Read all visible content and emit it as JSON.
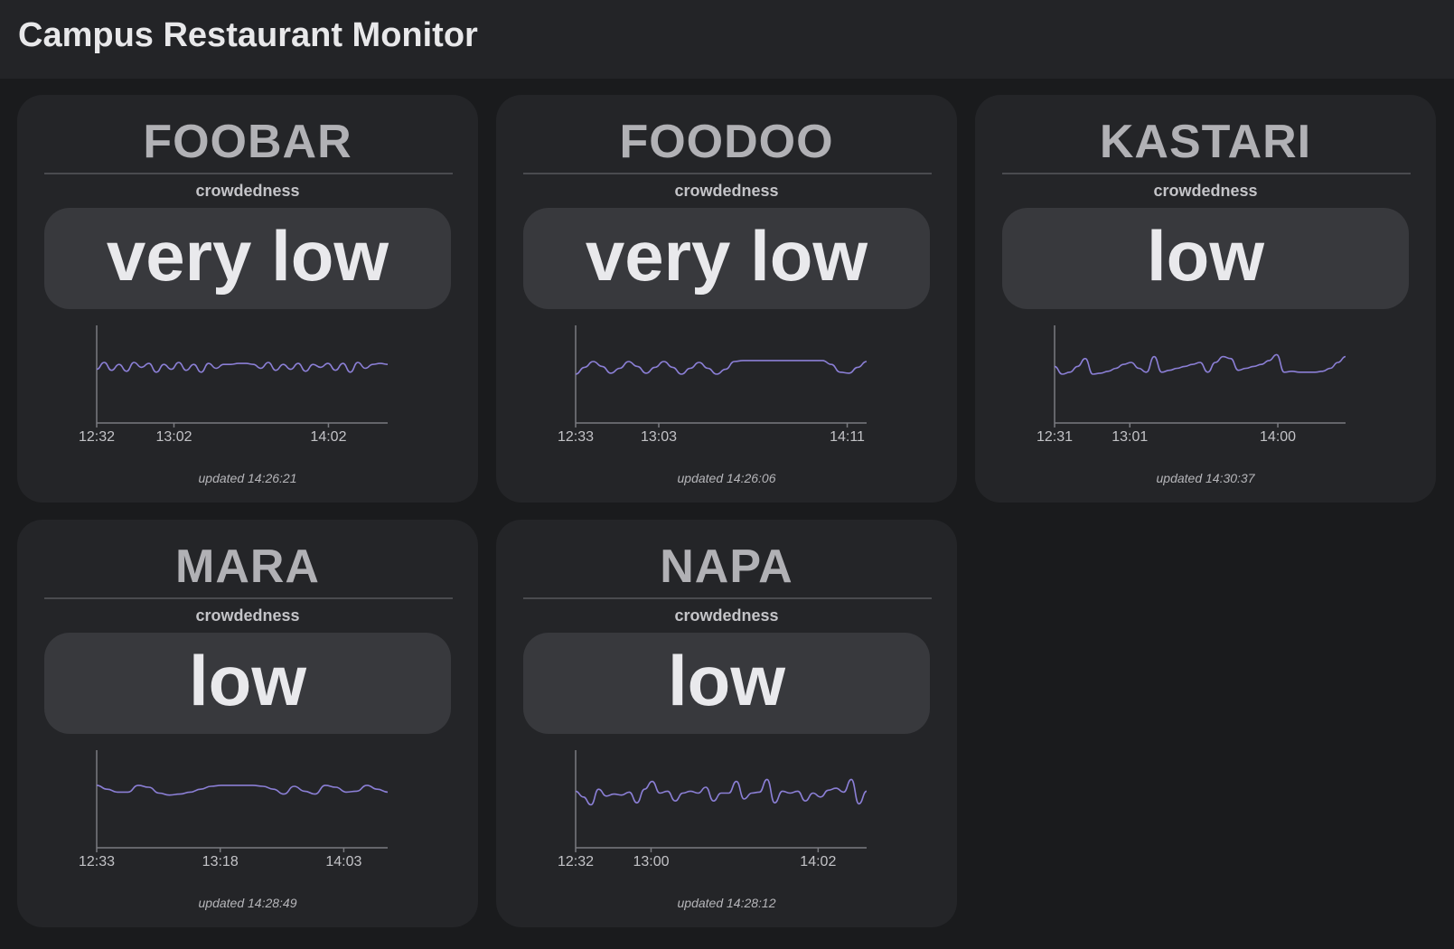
{
  "header": {
    "title": "Campus Restaurant Monitor"
  },
  "theme": {
    "line_color": "#8b7fd6",
    "axis_color": "#7a7b80"
  },
  "restaurants": [
    {
      "name": "FOOBAR",
      "metric_label": "crowdedness",
      "level": "very low",
      "updated": "updated 14:26:21",
      "chart_data": {
        "type": "line",
        "x_start": "12:32",
        "x_end": "14:25",
        "x_ticks": [
          "12:32",
          "13:02",
          "14:02"
        ],
        "ylim": [
          0,
          100
        ],
        "values": [
          55,
          62,
          54,
          60,
          53,
          62,
          57,
          61,
          52,
          60,
          55,
          62,
          54,
          60,
          52,
          61,
          56,
          60,
          60,
          61,
          61,
          60,
          56,
          62,
          54,
          60,
          55,
          61,
          53,
          60,
          57,
          61,
          54,
          61,
          52,
          62,
          56,
          60,
          61,
          60
        ]
      }
    },
    {
      "name": "FOODOO",
      "metric_label": "crowdedness",
      "level": "very low",
      "updated": "updated 14:26:06",
      "chart_data": {
        "type": "line",
        "x_start": "12:33",
        "x_end": "14:18",
        "x_ticks": [
          "12:33",
          "13:03",
          "14:11"
        ],
        "ylim": [
          0,
          100
        ],
        "values": [
          50,
          57,
          63,
          58,
          51,
          56,
          63,
          58,
          51,
          57,
          63,
          57,
          50,
          56,
          62,
          56,
          50,
          55,
          63,
          64,
          64,
          64,
          64,
          64,
          64,
          64,
          64,
          64,
          64,
          60,
          52,
          51,
          57,
          63
        ]
      }
    },
    {
      "name": "KASTARI",
      "metric_label": "crowdedness",
      "level": "low",
      "updated": "updated 14:30:37",
      "chart_data": {
        "type": "line",
        "x_start": "12:31",
        "x_end": "14:27",
        "x_ticks": [
          "12:31",
          "13:01",
          "14:00"
        ],
        "ylim": [
          0,
          100
        ],
        "values": [
          58,
          50,
          52,
          58,
          66,
          50,
          51,
          53,
          56,
          60,
          62,
          56,
          52,
          68,
          52,
          54,
          56,
          58,
          60,
          62,
          52,
          62,
          68,
          66,
          54,
          56,
          58,
          60,
          64,
          70,
          52,
          53,
          52,
          52,
          52,
          53,
          56,
          62,
          68
        ]
      }
    },
    {
      "name": "MARA",
      "metric_label": "crowdedness",
      "level": "low",
      "updated": "updated 14:28:49",
      "chart_data": {
        "type": "line",
        "x_start": "12:33",
        "x_end": "14:19",
        "x_ticks": [
          "12:33",
          "13:18",
          "14:03"
        ],
        "ylim": [
          0,
          100
        ],
        "values": [
          64,
          60,
          57,
          57,
          64,
          62,
          56,
          54,
          55,
          57,
          60,
          63,
          64,
          64,
          64,
          64,
          63,
          60,
          55,
          63,
          58,
          55,
          64,
          62,
          57,
          58,
          64,
          60,
          57
        ]
      }
    },
    {
      "name": "NAPA",
      "metric_label": "crowdedness",
      "level": "low",
      "updated": "updated 14:28:12",
      "chart_data": {
        "type": "line",
        "x_start": "12:32",
        "x_end": "14:20",
        "x_ticks": [
          "12:32",
          "13:00",
          "14:02"
        ],
        "ylim": [
          0,
          100
        ],
        "values": [
          58,
          52,
          44,
          60,
          53,
          55,
          54,
          57,
          46,
          60,
          68,
          56,
          58,
          48,
          56,
          58,
          56,
          62,
          48,
          56,
          56,
          68,
          50,
          56,
          57,
          70,
          46,
          58,
          56,
          58,
          48,
          56,
          52,
          59,
          61,
          57,
          70,
          45,
          58
        ]
      }
    }
  ]
}
